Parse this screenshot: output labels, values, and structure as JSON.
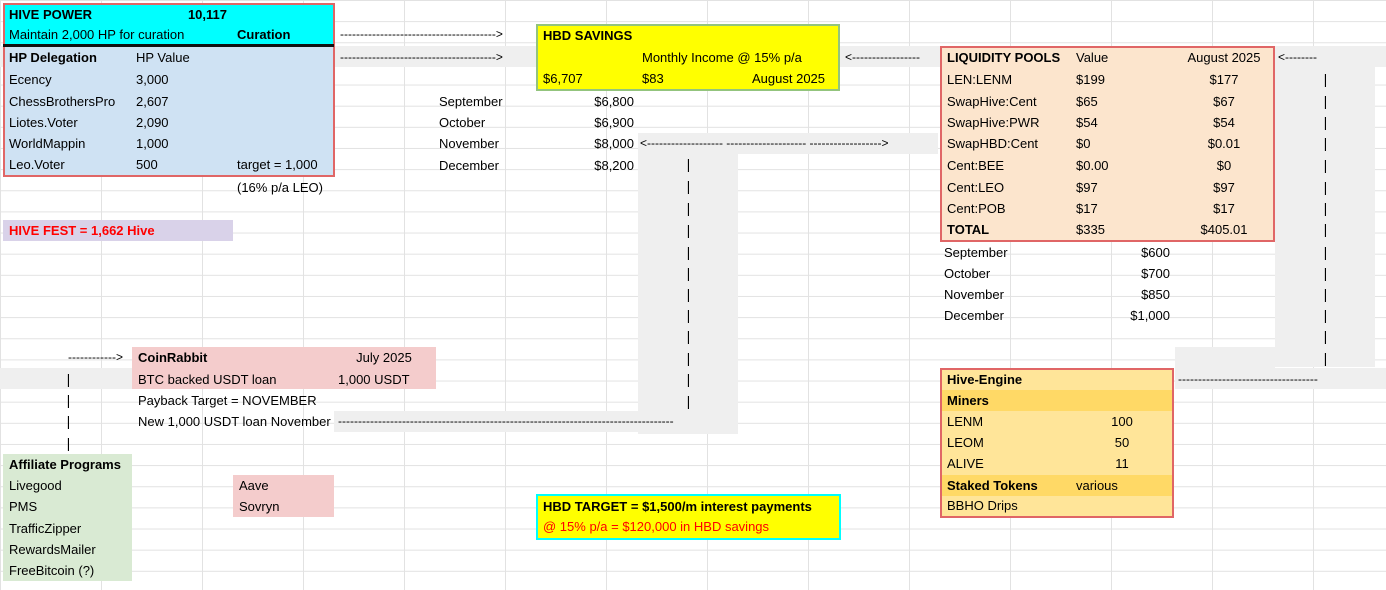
{
  "hive_power": {
    "title": "HIVE POWER",
    "value": "10,117",
    "maintain": "Maintain 2,000 HP for curation",
    "curation": "Curation"
  },
  "delegation": {
    "header": "HP Delegation",
    "value_header": "HP Value",
    "rows": [
      {
        "name": "Ecency",
        "value": "3,000"
      },
      {
        "name": "ChessBrothersPro",
        "value": "2,607"
      },
      {
        "name": "Liotes.Voter",
        "value": "2,090"
      },
      {
        "name": "WorldMappin",
        "value": "1,000"
      },
      {
        "name": "Leo.Voter",
        "value": "500"
      }
    ],
    "target": "target = 1,000",
    "leo_note": "(16% p/a LEO)"
  },
  "hive_fest": "HIVE FEST = 1,662 Hive",
  "hbd_savings": {
    "title": "HBD SAVINGS",
    "income_label": "Monthly Income @ 15% p/a",
    "amount": "$6,707",
    "income": "$83",
    "month": "August 2025",
    "projections": [
      {
        "month": "September",
        "value": "$6,800"
      },
      {
        "month": "October",
        "value": "$6,900"
      },
      {
        "month": "November",
        "value": "$8,000"
      },
      {
        "month": "December",
        "value": "$8,200"
      }
    ]
  },
  "liquidity": {
    "title": "LIQUIDITY POOLS",
    "value_header": "Value",
    "month_header": "August 2025",
    "rows": [
      {
        "name": "LEN:LENM",
        "value": "$199",
        "aug": "$177"
      },
      {
        "name": "SwapHive:Cent",
        "value": "$65",
        "aug": "$67"
      },
      {
        "name": "SwapHive:PWR",
        "value": "$54",
        "aug": "$54"
      },
      {
        "name": "SwapHBD:Cent",
        "value": "$0",
        "aug": "$0.01"
      },
      {
        "name": "Cent:BEE",
        "value": "$0.00",
        "aug": "$0"
      },
      {
        "name": "Cent:LEO",
        "value": "$97",
        "aug": "$97"
      },
      {
        "name": "Cent:POB",
        "value": "$17",
        "aug": "$17"
      }
    ],
    "total_label": "TOTAL",
    "total_value": "$335",
    "total_aug": "$405.01",
    "projections": [
      {
        "month": "September",
        "value": "$600"
      },
      {
        "month": "October",
        "value": "$700"
      },
      {
        "month": "November",
        "value": "$850"
      },
      {
        "month": "December",
        "value": "$1,000"
      }
    ]
  },
  "coinrabbit": {
    "title": "CoinRabbit",
    "month": "July 2025",
    "loan_label": "BTC backed USDT loan",
    "loan_value": "1,000 USDT",
    "payback": "Payback Target = NOVEMBER",
    "new_loan": "New 1,000 USDT loan November"
  },
  "affiliate": {
    "title": "Affiliate Programs",
    "items": [
      "Livegood",
      "PMS",
      "TrafficZipper",
      "RewardsMailer",
      "FreeBitcoin (?)"
    ],
    "defi": [
      "Aave",
      "Sovryn"
    ]
  },
  "hbd_target": {
    "line1": "HBD TARGET = $1,500/m interest payments",
    "line2": "@ 15% p/a = $120,000 in HBD savings"
  },
  "hive_engine": {
    "title": "Hive-Engine",
    "miners_label": "Miners",
    "miners": [
      {
        "name": "LENM",
        "value": "100"
      },
      {
        "name": "LEOM",
        "value": "50"
      },
      {
        "name": "ALIVE",
        "value": "11"
      }
    ],
    "staked_label": "Staked Tokens",
    "staked_value": "various",
    "bbho": "BBHO Drips"
  },
  "colors": {
    "cyan": "#00ffff",
    "light_blue": "#cfe2f3",
    "yellow": "#ffff00",
    "peach": "#fce5cd",
    "orange_light": "#ffe599",
    "orange": "#ffd966",
    "pink": "#f4cccc",
    "lavender": "#d9d2e9",
    "green": "#d9ead3",
    "grey": "#efefef"
  }
}
